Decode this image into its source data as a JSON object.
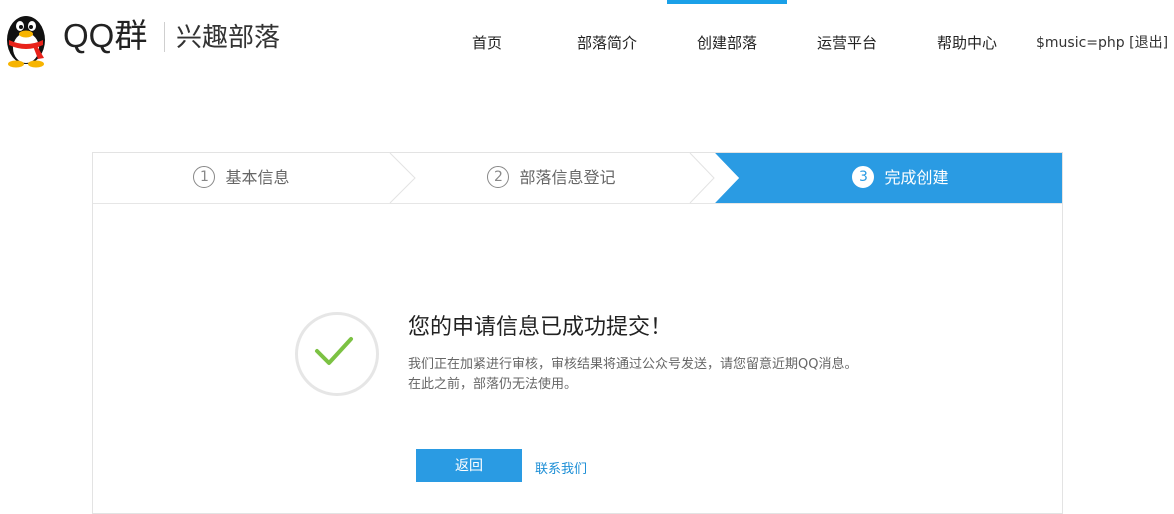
{
  "header": {
    "brand_name": "QQ群",
    "brand_sub": "兴趣部落",
    "nav": [
      {
        "label": "首页"
      },
      {
        "label": "部落简介"
      },
      {
        "label": "创建部落",
        "active": true
      },
      {
        "label": "运营平台"
      },
      {
        "label": "帮助中心"
      }
    ],
    "user": {
      "name": "$music=php",
      "logout_label": "[退出]"
    }
  },
  "steps": [
    {
      "number": "1",
      "label": "基本信息"
    },
    {
      "number": "2",
      "label": "部落信息登记"
    },
    {
      "number": "3",
      "label": "完成创建",
      "active": true
    }
  ],
  "result": {
    "title": "您的申请信息已成功提交！",
    "desc_line1": "我们正在加紧进行审核，审核结果将通过公众号发送，请您留意近期QQ消息。",
    "desc_line2": "在此之前，部落仍无法使用。",
    "back_button": "返回",
    "contact_link": "联系我们"
  },
  "colors": {
    "accent": "#2a9be3",
    "nav_active_bar": "#1aa0e8",
    "success_check": "#7cc243",
    "link": "#1c8ed6"
  },
  "icons": {
    "logo": "qq-penguin-icon",
    "success": "checkmark-icon"
  }
}
